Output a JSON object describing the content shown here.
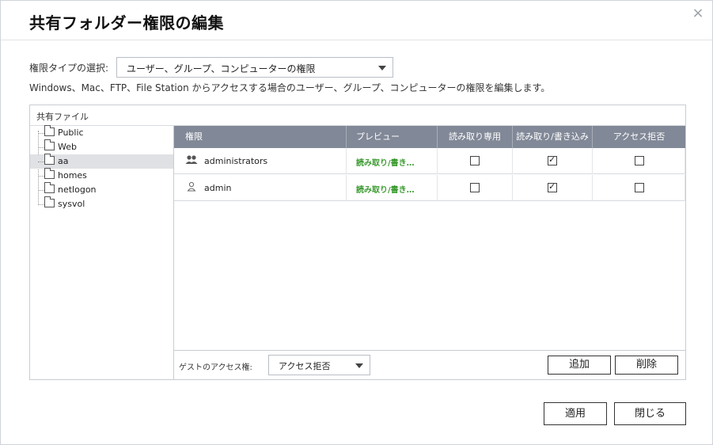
{
  "dialog": {
    "title": "共有フォルダー権限の編集",
    "close_symbol": "×"
  },
  "permission_type": {
    "label": "権限タイプの選択:",
    "selected": "ユーザー、グループ、コンピューターの権限"
  },
  "description": "Windows、Mac、FTP、File Station からアクセスする場合のユーザー、グループ、コンピューターの権限を編集します。",
  "panel": {
    "header": "共有ファイル"
  },
  "tree": {
    "items": [
      {
        "label": "Public",
        "selected": false
      },
      {
        "label": "Web",
        "selected": false
      },
      {
        "label": "aa",
        "selected": true
      },
      {
        "label": "homes",
        "selected": false
      },
      {
        "label": "netlogon",
        "selected": false
      },
      {
        "label": "sysvol",
        "selected": false
      }
    ]
  },
  "grid": {
    "columns": [
      "権限",
      "プレビュー",
      "読み取り専用",
      "読み取り/書き込み",
      "アクセス拒否"
    ],
    "rows": [
      {
        "icon": "group-icon",
        "name": "administrators",
        "preview": "読み取り/書き…",
        "read_only": false,
        "read_write": true,
        "deny": false
      },
      {
        "icon": "user-icon",
        "name": "admin",
        "preview": "読み取り/書き…",
        "read_only": false,
        "read_write": true,
        "deny": false
      }
    ]
  },
  "guest": {
    "label": "ゲストのアクセス権:",
    "selected": "アクセス拒否"
  },
  "buttons": {
    "add": "追加",
    "remove": "削除",
    "apply": "適用",
    "close": "閉じる"
  },
  "colors": {
    "grid_header": "#818897",
    "preview_text": "#3a9a2f",
    "selected_row": "#dfe1e4"
  }
}
